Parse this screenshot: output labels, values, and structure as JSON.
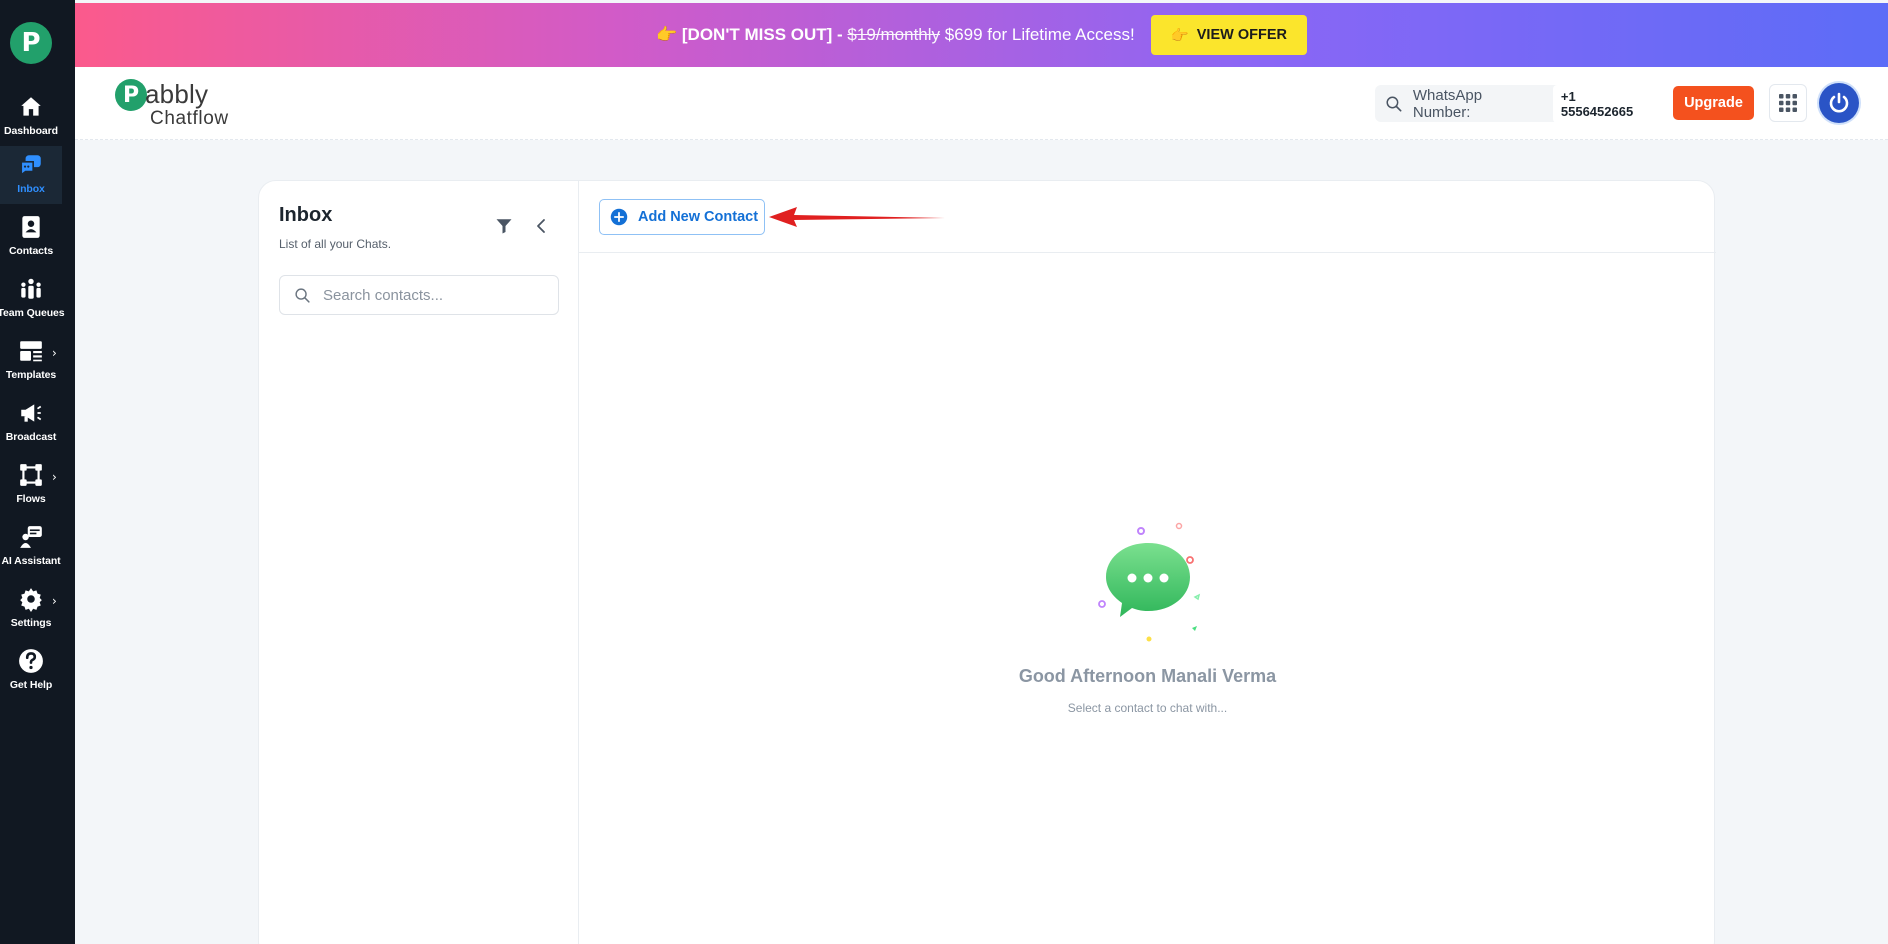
{
  "sidebar": {
    "logo_letter": "P",
    "items": [
      {
        "label": "Dashboard",
        "icon": "home-icon"
      },
      {
        "label": "Inbox",
        "icon": "chat-icon",
        "active": true
      },
      {
        "label": "Contacts",
        "icon": "contact-book-icon"
      },
      {
        "label": "Team Queues",
        "icon": "team-icon"
      },
      {
        "label": "Templates",
        "icon": "template-icon",
        "has_chevron": true
      },
      {
        "label": "Broadcast",
        "icon": "megaphone-icon"
      },
      {
        "label": "Flows",
        "icon": "flow-icon",
        "has_chevron": true
      },
      {
        "label": "AI Assistant",
        "icon": "ai-assistant-icon"
      },
      {
        "label": "Settings",
        "icon": "gear-icon",
        "has_chevron": true
      },
      {
        "label": "Get Help",
        "icon": "help-icon"
      }
    ]
  },
  "banner": {
    "emoji": "👉",
    "highlight": "[DON'T MISS OUT]",
    "separator": " - ",
    "old_price": "$19/monthly",
    "offer": " $699 for Lifetime Access!",
    "button_emoji": "👉",
    "button_label": "VIEW OFFER",
    "gradient_start": "#fb5a8c",
    "gradient_end": "#5c6cf7",
    "button_color": "#fbe52c"
  },
  "header": {
    "brand_letter": "P",
    "brand_name": "abbly",
    "brand_product": "Chatflow",
    "whatsapp_label": "WhatsApp Number:",
    "whatsapp_number": "+1 5556452665",
    "upgrade_label": "Upgrade",
    "upgrade_color": "#f4511e"
  },
  "inbox": {
    "title": "Inbox",
    "subtitle": "List of all your Chats.",
    "search_placeholder": "Search contacts..."
  },
  "chat": {
    "add_contact_label": "Add New Contact",
    "greeting": "Good Afternoon Manali Verma",
    "hint": "Select a contact to chat with..."
  },
  "colors": {
    "sidebar_bg": "#111822",
    "active_accent": "#2f8fff",
    "brand_green": "#22a06b",
    "annotation_arrow": "#e02020"
  }
}
